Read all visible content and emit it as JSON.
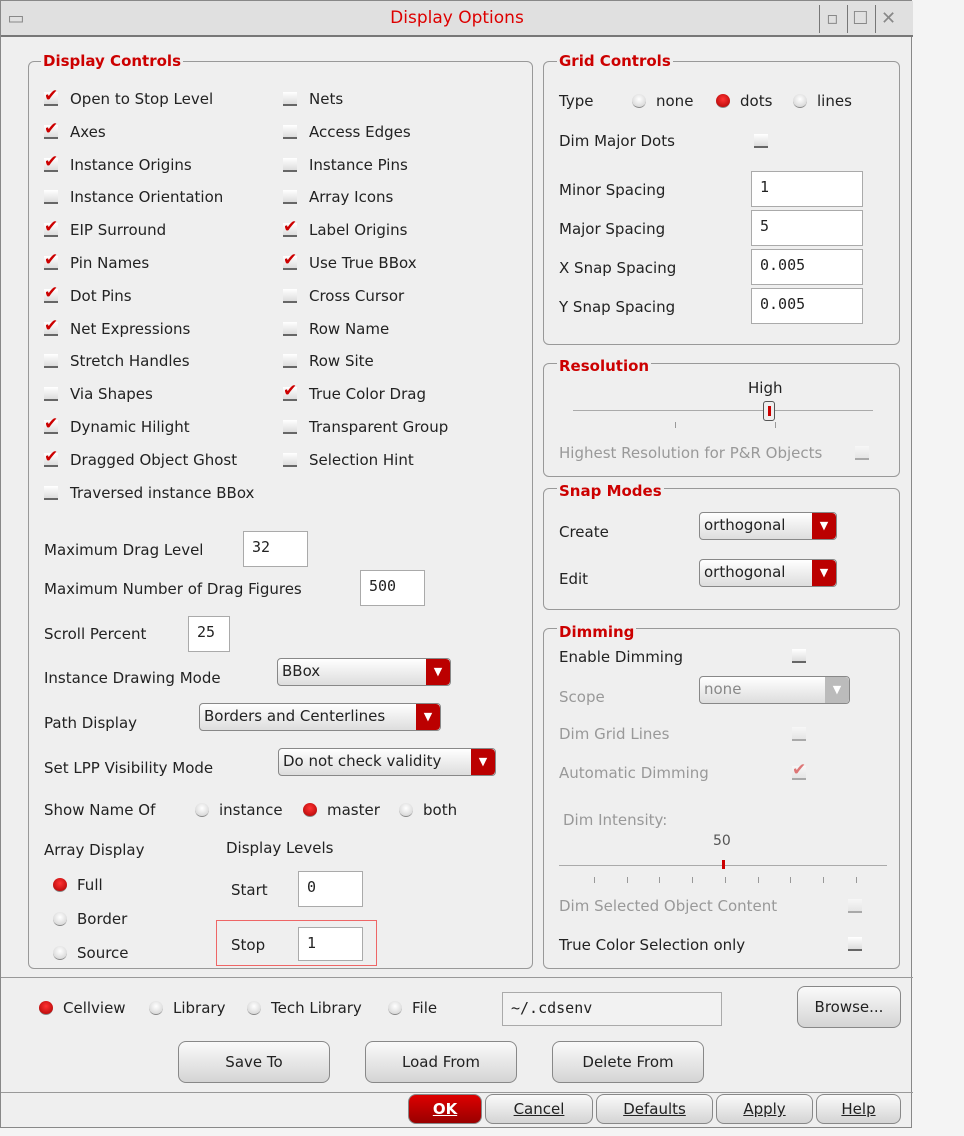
{
  "window": {
    "title": "Display Options"
  },
  "display_controls": {
    "title": "Display Controls",
    "left": [
      {
        "label": "Open to Stop Level",
        "checked": true
      },
      {
        "label": "Axes",
        "checked": true
      },
      {
        "label": "Instance Origins",
        "checked": true
      },
      {
        "label": "Instance Orientation",
        "checked": false
      },
      {
        "label": "EIP Surround",
        "checked": true
      },
      {
        "label": "Pin Names",
        "checked": true
      },
      {
        "label": "Dot Pins",
        "checked": true
      },
      {
        "label": "Net Expressions",
        "checked": true
      },
      {
        "label": "Stretch Handles",
        "checked": false
      },
      {
        "label": "Via Shapes",
        "checked": false
      },
      {
        "label": "Dynamic Hilight",
        "checked": true
      },
      {
        "label": "Dragged Object Ghost",
        "checked": true
      },
      {
        "label": "Traversed instance BBox",
        "checked": false
      }
    ],
    "right": [
      {
        "label": "Nets",
        "checked": false
      },
      {
        "label": "Access Edges",
        "checked": false
      },
      {
        "label": "Instance Pins",
        "checked": false
      },
      {
        "label": "Array Icons",
        "checked": false
      },
      {
        "label": "Label Origins",
        "checked": true
      },
      {
        "label": "Use True BBox",
        "checked": true
      },
      {
        "label": "Cross Cursor",
        "checked": false
      },
      {
        "label": "Row Name",
        "checked": false
      },
      {
        "label": "Row Site",
        "checked": false
      },
      {
        "label": "True Color Drag",
        "checked": true
      },
      {
        "label": "Transparent Group",
        "checked": false
      },
      {
        "label": "Selection Hint",
        "checked": false
      }
    ],
    "max_drag_level": {
      "label": "Maximum Drag Level",
      "value": "32"
    },
    "max_drag_figures": {
      "label": "Maximum Number of Drag Figures",
      "value": "500"
    },
    "scroll_percent": {
      "label": "Scroll Percent",
      "value": "25"
    },
    "instance_drawing_mode": {
      "label": "Instance Drawing Mode",
      "value": "BBox"
    },
    "path_display": {
      "label": "Path Display",
      "value": "Borders and Centerlines"
    },
    "lpp_visibility": {
      "label": "Set LPP Visibility Mode",
      "value": "Do not check validity"
    },
    "show_name_of": {
      "label": "Show Name Of",
      "options": [
        "instance",
        "master",
        "both"
      ],
      "selected": "master"
    },
    "array_display": {
      "label": "Array Display",
      "options": [
        "Full",
        "Border",
        "Source"
      ],
      "selected": "Full"
    },
    "display_levels": {
      "label": "Display Levels",
      "start_label": "Start",
      "start": "0",
      "stop_label": "Stop",
      "stop": "1"
    }
  },
  "grid_controls": {
    "title": "Grid Controls",
    "type_label": "Type",
    "types": [
      "none",
      "dots",
      "lines"
    ],
    "selected": "dots",
    "dim_major_dots": "Dim Major Dots",
    "fields": [
      {
        "label": "Minor Spacing",
        "value": "1"
      },
      {
        "label": "Major Spacing",
        "value": "5"
      },
      {
        "label": "X Snap Spacing",
        "value": "0.005"
      },
      {
        "label": "Y Snap Spacing",
        "value": "0.005"
      }
    ]
  },
  "resolution": {
    "title": "Resolution",
    "value_label": "High",
    "highest_pr": "Highest Resolution for P&R Objects"
  },
  "snap_modes": {
    "title": "Snap Modes",
    "create_label": "Create",
    "create": "orthogonal",
    "edit_label": "Edit",
    "edit": "orthogonal"
  },
  "dimming": {
    "title": "Dimming",
    "enable": "Enable Dimming",
    "scope_label": "Scope",
    "scope": "none",
    "dim_grid": "Dim Grid Lines",
    "auto": "Automatic Dimming",
    "intensity_label": "Dim Intensity:",
    "intensity": 50,
    "intensity_text": "50",
    "dim_selected": "Dim Selected Object Content",
    "true_color": "True Color Selection only"
  },
  "source": {
    "options": [
      "Cellview",
      "Library",
      "Tech Library",
      "File"
    ],
    "selected": "Cellview",
    "path": "~/.cdsenv",
    "browse": "Browse..."
  },
  "actions": {
    "save_to": "Save To",
    "load_from": "Load From",
    "delete_from": "Delete From"
  },
  "footer": {
    "ok": "OK",
    "cancel": "Cancel",
    "defaults": "Defaults",
    "apply": "Apply",
    "help": "Help"
  }
}
